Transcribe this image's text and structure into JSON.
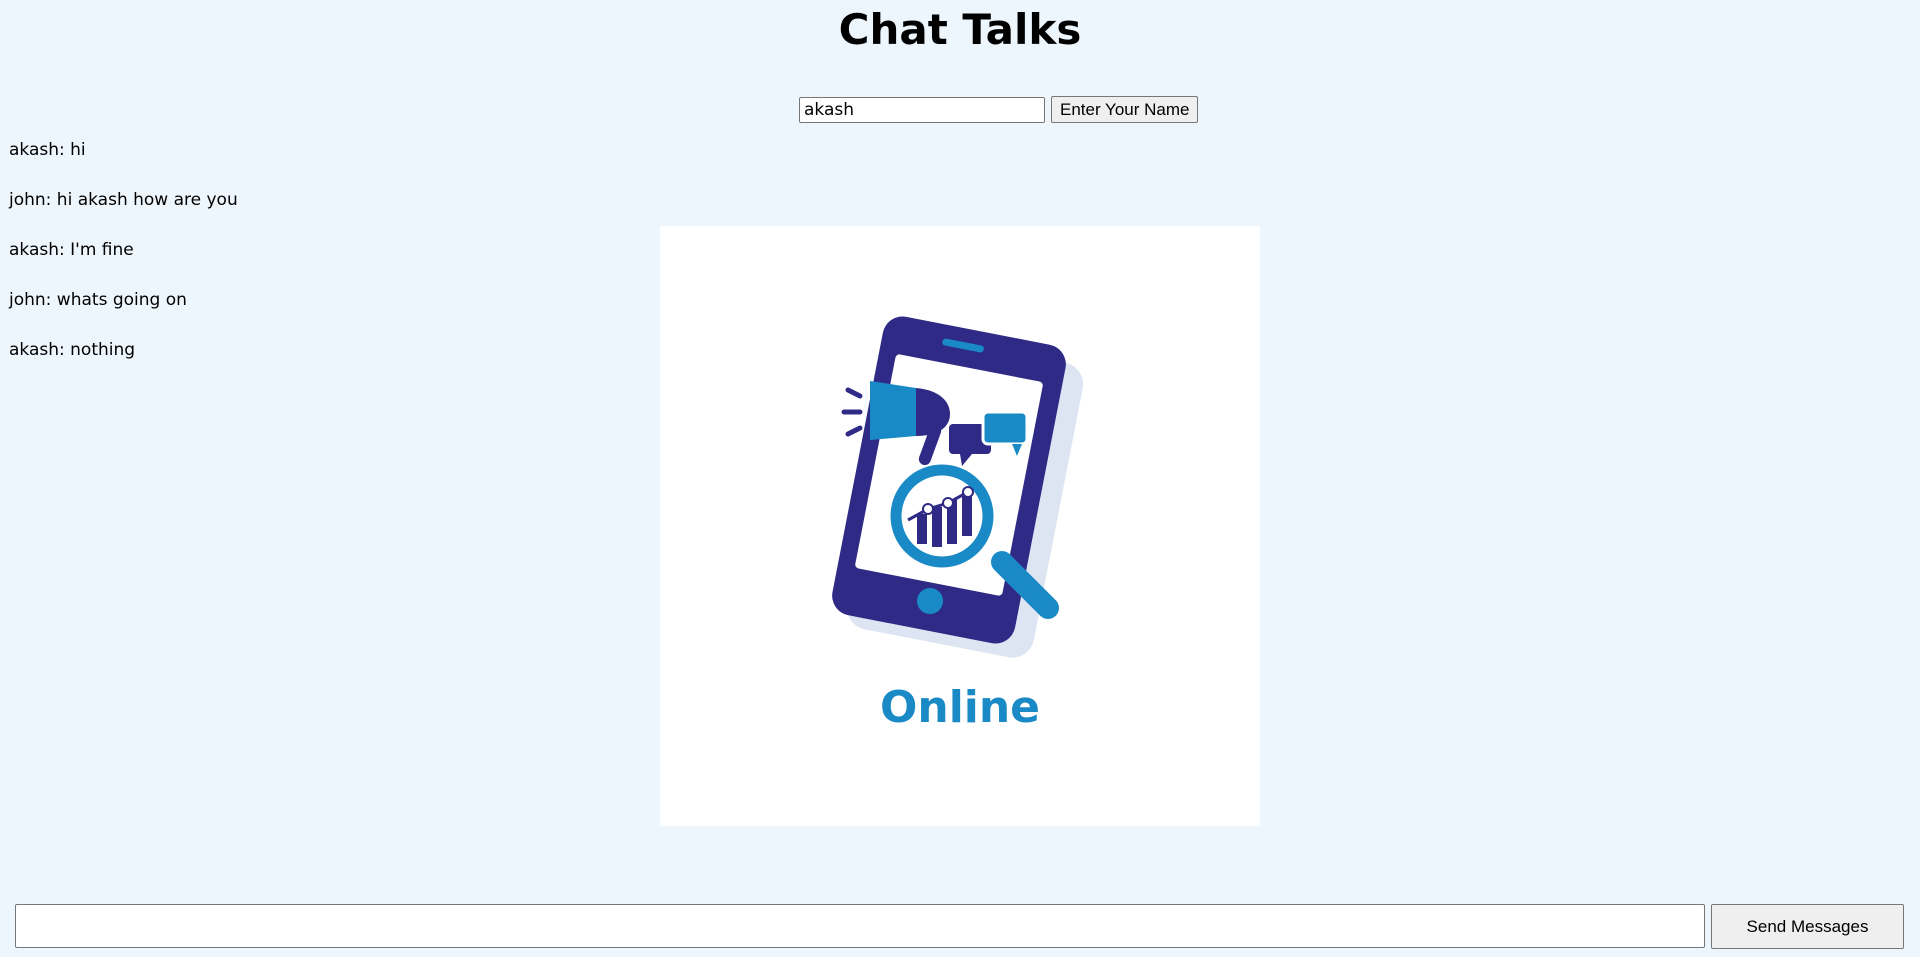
{
  "header": {
    "title": "Chat Talks"
  },
  "name_form": {
    "input_value": "akash",
    "button_label": "Enter Your Name"
  },
  "messages": [
    {
      "text": "akash: hi"
    },
    {
      "text": "john: hi akash how are you"
    },
    {
      "text": "akash: I'm fine"
    },
    {
      "text": "john: whats going on"
    },
    {
      "text": "akash: nothing"
    }
  ],
  "hero_image": {
    "caption": "Online",
    "colors": {
      "navy": "#2e2a85",
      "blue": "#1a8ac6",
      "shadow": "#dde5f3"
    }
  },
  "composer": {
    "input_value": "",
    "send_label": "Send Messages"
  }
}
